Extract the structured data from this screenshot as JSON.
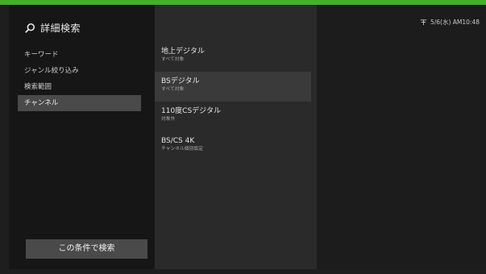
{
  "colors": {
    "accent": "#43b02a"
  },
  "left_panel": {
    "title": "詳細検索",
    "menu_items": [
      {
        "label": "キーワード"
      },
      {
        "label": "ジャンル絞り込み"
      },
      {
        "label": "検索範囲"
      },
      {
        "label": "チャンネル"
      }
    ],
    "selected_index": 3,
    "search_button_label": "この条件で検索"
  },
  "channels": [
    {
      "name": "地上デジタル",
      "sub": "すべて対象"
    },
    {
      "name": "BSデジタル",
      "sub": "すべて対象"
    },
    {
      "name": "110度CSデジタル",
      "sub": "対象外"
    },
    {
      "name": "BS/CS 4K",
      "sub": "チャンネル個別設定"
    }
  ],
  "channels_selected_index": 1,
  "status": {
    "datetime": "5/6(水) AM10:48",
    "icon": "antenna-icon"
  }
}
